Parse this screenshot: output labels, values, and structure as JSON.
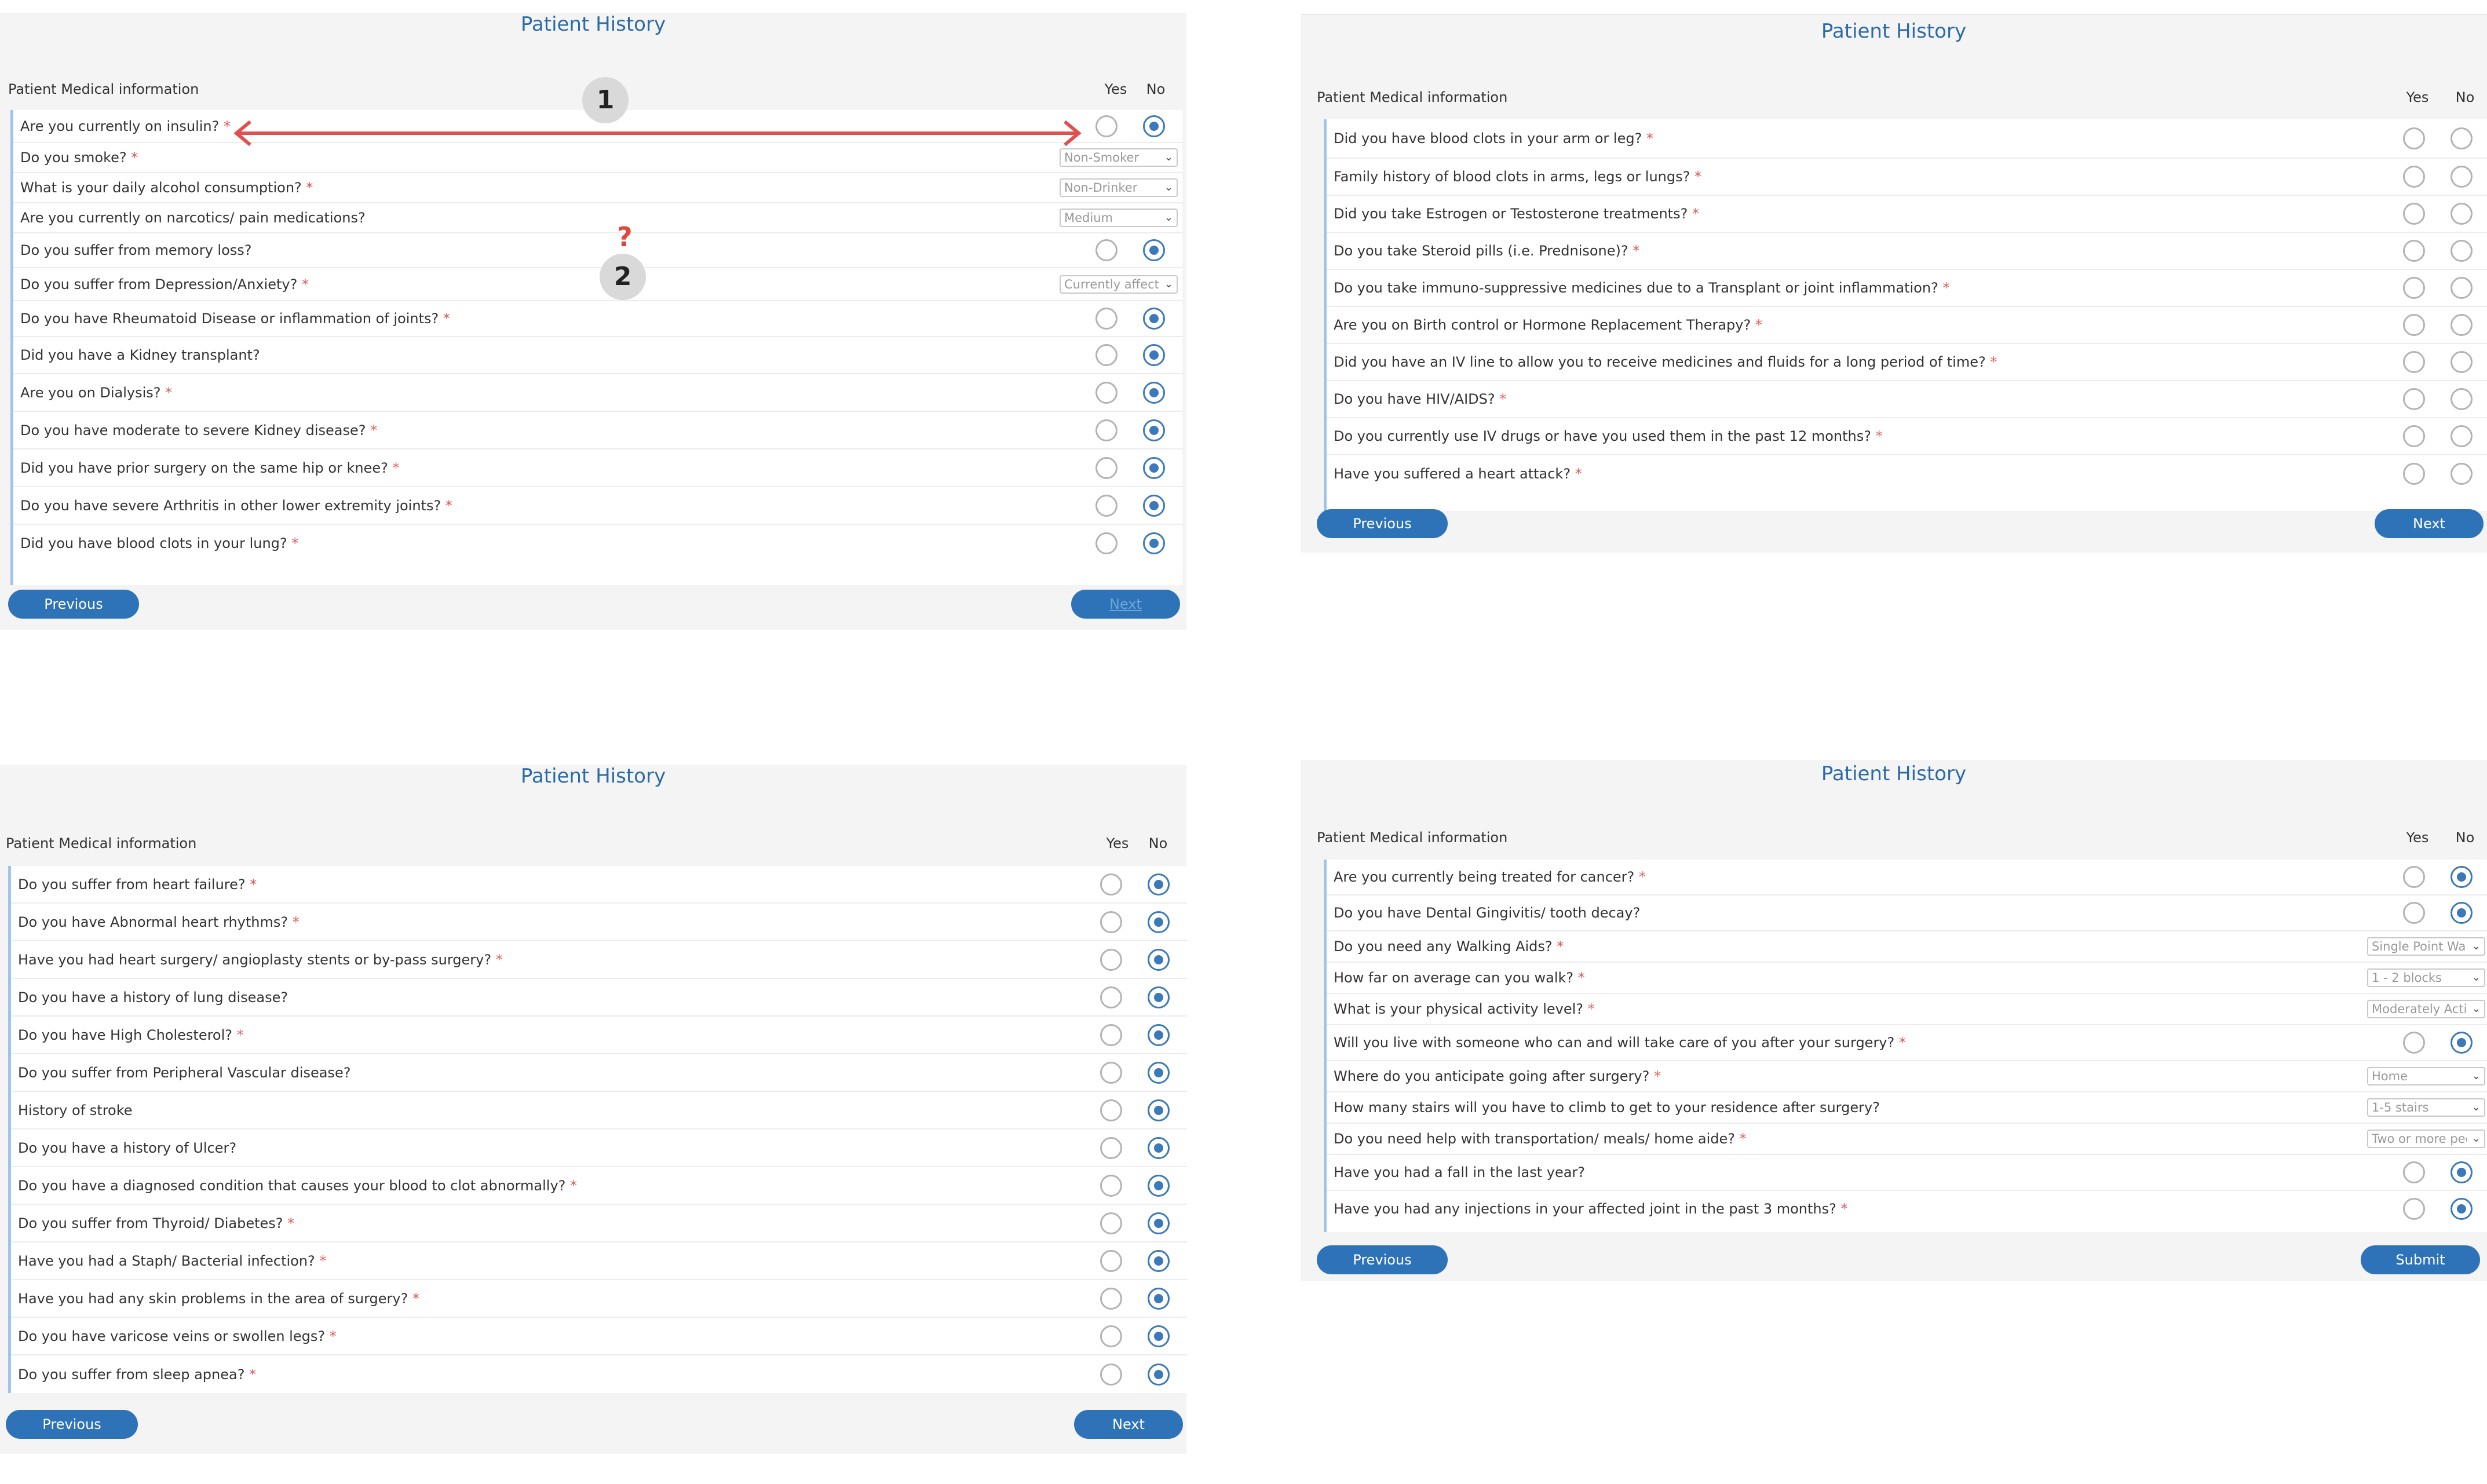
{
  "panel_title": "Patient History",
  "section_label": "Patient Medical information",
  "yes_label": "Yes",
  "no_label": "No",
  "required_mark": "*",
  "panels": [
    {
      "questions": [
        {
          "text": "Are you currently on insulin?",
          "required": true,
          "type": "radio",
          "answer": "No"
        },
        {
          "text": "Do you smoke?",
          "required": true,
          "type": "select",
          "value": "Non-Smoker"
        },
        {
          "text": "What is your daily alcohol consumption?",
          "required": true,
          "type": "select",
          "value": "Non-Drinker"
        },
        {
          "text": "Are you currently on narcotics/ pain medications?",
          "required": false,
          "type": "select",
          "value": "Medium"
        },
        {
          "text": "Do you suffer from memory loss?",
          "required": false,
          "type": "radio",
          "answer": "No"
        },
        {
          "text": "Do you suffer from Depression/Anxiety?",
          "required": true,
          "type": "select",
          "value": "Currently affected"
        },
        {
          "text": "Do you have Rheumatoid Disease or inflammation of joints?",
          "required": true,
          "type": "radio",
          "answer": "No"
        },
        {
          "text": "Did you have a Kidney transplant?",
          "required": false,
          "type": "radio",
          "answer": "No"
        },
        {
          "text": "Are you on Dialysis?",
          "required": true,
          "type": "radio",
          "answer": "No"
        },
        {
          "text": "Do you have moderate to severe Kidney disease?",
          "required": true,
          "type": "radio",
          "answer": "No"
        },
        {
          "text": "Did you have prior surgery on the same hip or knee?",
          "required": true,
          "type": "radio",
          "answer": "No"
        },
        {
          "text": "Do you have severe Arthritis in other lower extremity joints?",
          "required": true,
          "type": "radio",
          "answer": "No"
        },
        {
          "text": "Did you have blood clots in your lung?",
          "required": true,
          "type": "radio",
          "answer": "No"
        }
      ],
      "prev_label": "Previous",
      "next_label": "Next"
    },
    {
      "questions": [
        {
          "text": "Did you have blood clots in your arm or leg?",
          "required": true,
          "type": "radio",
          "answer": ""
        },
        {
          "text": "Family history of blood clots in arms, legs or lungs?",
          "required": true,
          "type": "radio",
          "answer": ""
        },
        {
          "text": "Did you take Estrogen or Testosterone treatments?",
          "required": true,
          "type": "radio",
          "answer": ""
        },
        {
          "text": "Do you take Steroid pills (i.e. Prednisone)?",
          "required": true,
          "type": "radio",
          "answer": ""
        },
        {
          "text": "Do you take immuno-suppressive medicines due to a Transplant or joint inflammation?",
          "required": true,
          "type": "radio",
          "answer": ""
        },
        {
          "text": "Are you on Birth control or Hormone Replacement Therapy?",
          "required": true,
          "type": "radio",
          "answer": ""
        },
        {
          "text": "Did you have an IV line to allow you to receive medicines and fluids for a long period of time?",
          "required": true,
          "type": "radio",
          "answer": ""
        },
        {
          "text": "Do you have HIV/AIDS?",
          "required": true,
          "type": "radio",
          "answer": ""
        },
        {
          "text": "Do you currently use IV drugs or have you used them in the past 12 months?",
          "required": true,
          "type": "radio",
          "answer": ""
        },
        {
          "text": "Have you suffered a heart attack?",
          "required": true,
          "type": "radio",
          "answer": ""
        }
      ],
      "prev_label": "Previous",
      "next_label": "Next"
    },
    {
      "questions": [
        {
          "text": "Do you suffer from heart failure?",
          "required": true,
          "type": "radio",
          "answer": "No"
        },
        {
          "text": "Do you have Abnormal heart rhythms?",
          "required": true,
          "type": "radio",
          "answer": "No"
        },
        {
          "text": "Have you had heart surgery/ angioplasty stents or by-pass surgery?",
          "required": true,
          "type": "radio",
          "answer": "No"
        },
        {
          "text": "Do you have a history of lung disease?",
          "required": false,
          "type": "radio",
          "answer": "No"
        },
        {
          "text": "Do you have High Cholesterol?",
          "required": true,
          "type": "radio",
          "answer": "No"
        },
        {
          "text": "Do you suffer from Peripheral Vascular disease?",
          "required": false,
          "type": "radio",
          "answer": "No"
        },
        {
          "text": "History of stroke",
          "required": false,
          "type": "radio",
          "answer": "No"
        },
        {
          "text": "Do you have a history of Ulcer?",
          "required": false,
          "type": "radio",
          "answer": "No"
        },
        {
          "text": "Do you have a diagnosed condition that causes your blood to clot abnormally?",
          "required": true,
          "type": "radio",
          "answer": "No"
        },
        {
          "text": "Do you suffer from Thyroid/ Diabetes?",
          "required": true,
          "type": "radio",
          "answer": "No"
        },
        {
          "text": "Have you had a Staph/ Bacterial infection?",
          "required": true,
          "type": "radio",
          "answer": "No"
        },
        {
          "text": "Have you had any skin problems in the area of surgery?",
          "required": true,
          "type": "radio",
          "answer": "No"
        },
        {
          "text": "Do you have varicose veins or swollen legs?",
          "required": true,
          "type": "radio",
          "answer": "No"
        },
        {
          "text": "Do you suffer from sleep apnea?",
          "required": true,
          "type": "radio",
          "answer": "No"
        }
      ],
      "prev_label": "Previous",
      "next_label": "Next"
    },
    {
      "questions": [
        {
          "text": "Are you currently being treated for cancer?",
          "required": true,
          "type": "radio",
          "answer": "No"
        },
        {
          "text": "Do you have Dental Gingivitis/ tooth decay?",
          "required": false,
          "type": "radio",
          "answer": "No"
        },
        {
          "text": "Do you need any Walking Aids?",
          "required": true,
          "type": "select",
          "value": "Single Point Walker"
        },
        {
          "text": "How far on average can you walk?",
          "required": true,
          "type": "select",
          "value": "1 - 2 blocks"
        },
        {
          "text": "What is your physical activity level?",
          "required": true,
          "type": "select",
          "value": "Moderately Active"
        },
        {
          "text": "Will you live with someone who can and will take care of you after your surgery?",
          "required": true,
          "type": "radio",
          "answer": "No"
        },
        {
          "text": "Where do you anticipate going after surgery?",
          "required": true,
          "type": "select",
          "value": "Home"
        },
        {
          "text": "How many stairs will you have to climb to get to your residence after surgery?",
          "required": false,
          "type": "select",
          "value": "1-5 stairs"
        },
        {
          "text": "Do you need help with transportation/ meals/ home aide?",
          "required": true,
          "type": "select",
          "value": "Two or more people"
        },
        {
          "text": "Have you had a fall in the last year?",
          "required": false,
          "type": "radio",
          "answer": "No"
        },
        {
          "text": "Have you had any injections in your affected joint in the past 3 months?",
          "required": true,
          "type": "radio",
          "answer": "No"
        }
      ],
      "prev_label": "Previous",
      "next_label": "Submit"
    }
  ],
  "annotations": {
    "callout_1": "1",
    "callout_2": "2",
    "question_mark": "?",
    "arrow_color": "#e05050"
  }
}
